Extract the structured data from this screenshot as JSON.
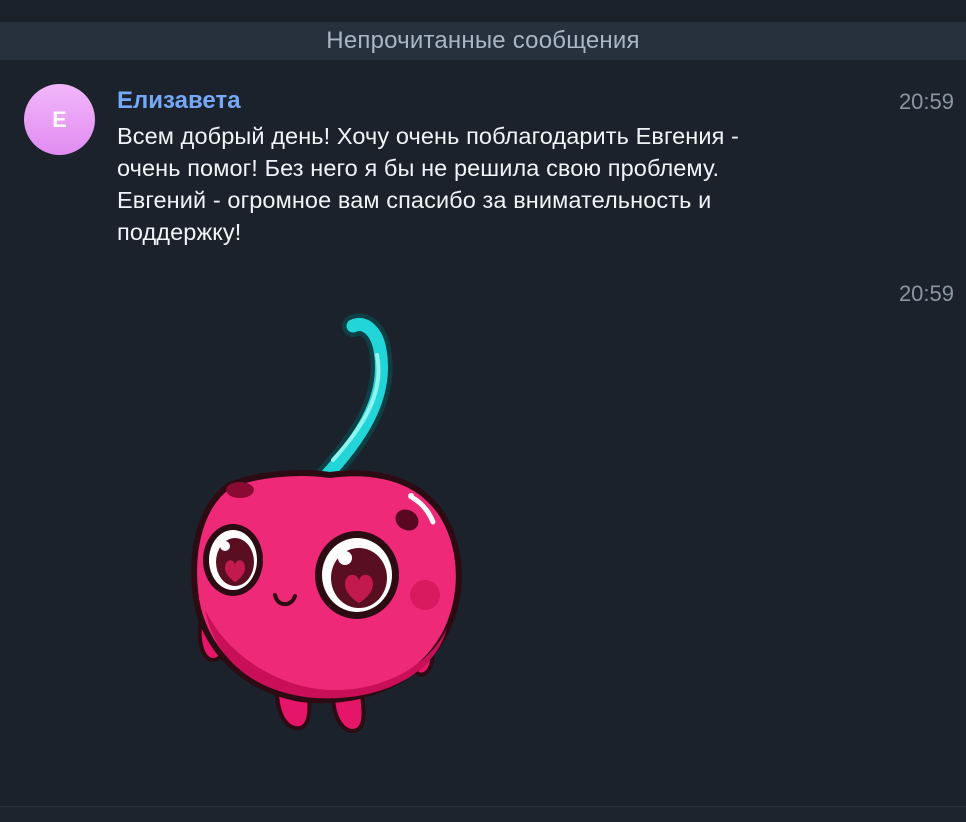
{
  "unread_separator": "Непрочитанные сообщения",
  "messages": [
    {
      "avatar_letter": "Е",
      "sender": "Елизавета",
      "time": "20:59",
      "text": "Всем добрый день! Хочу очень поблагодарить Евгения -\nочень помог! Без него я бы не решила свою проблему.\nЕвгений - огромное вам спасибо за внимательность и\nподдержку!"
    },
    {
      "time": "20:59",
      "sticker": "cherry-sticker"
    }
  ],
  "colors": {
    "background": "#1b222c",
    "separator_bg": "#27313e",
    "sender_name": "#75a8f7",
    "message_text": "#f1f4f7",
    "timestamp": "#8a96a3"
  }
}
